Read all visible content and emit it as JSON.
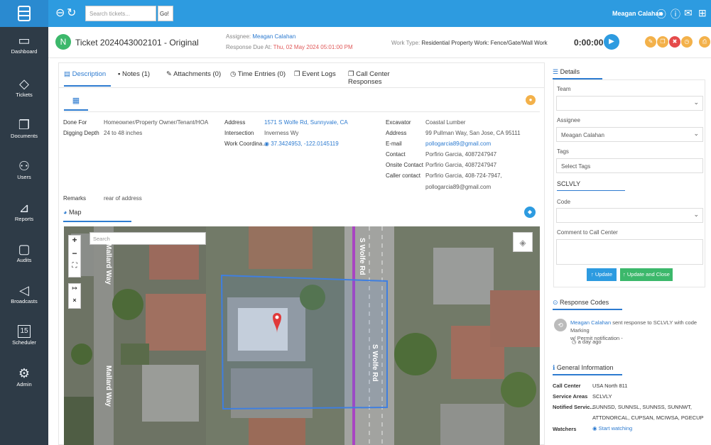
{
  "topbar": {
    "search_placeholder": "Search tickets...",
    "go_label": "Go!",
    "user_name": "Meagan Calahan"
  },
  "sidebar": {
    "items": [
      {
        "label": "Dashboard",
        "icon": "monitor-icon"
      },
      {
        "label": "Tickets",
        "icon": "tag-icon"
      },
      {
        "label": "Documents",
        "icon": "documents-icon"
      },
      {
        "label": "Users",
        "icon": "users-icon"
      },
      {
        "label": "Reports",
        "icon": "chart-icon"
      },
      {
        "label": "Audits",
        "icon": "audits-icon"
      },
      {
        "label": "Broadcasts",
        "icon": "megaphone-icon"
      },
      {
        "label": "Scheduler",
        "icon": "calendar-icon"
      },
      {
        "label": "Admin",
        "icon": "gear-icon"
      }
    ],
    "calendar_day": "15"
  },
  "ticket": {
    "avatar_letter": "N",
    "title": "Ticket 2024043002101 - Original",
    "assignee_label": "Assignee:",
    "assignee_value": "Meagan Calahan",
    "due_label": "Response Due At:",
    "due_value": "Thu, 02 May 2024 05:01:00 PM",
    "worktype_label": "Work Type:",
    "worktype_value": "Residential Property Work: Fence/Gate/Wall Work",
    "timer": "0:00:00"
  },
  "tabs": [
    {
      "label": "Description"
    },
    {
      "label": "Notes (1)"
    },
    {
      "label": "Attachments (0)"
    },
    {
      "label": "Time Entries (0)"
    },
    {
      "label": "Event Logs"
    },
    {
      "label": "Call Center Responses"
    }
  ],
  "description": {
    "done_for_label": "Done For",
    "done_for_value": "Homeowner/Property Owner/Tenant/HOA",
    "digging_depth_label": "Digging Depth",
    "digging_depth_value": "24 to 48 inches",
    "address_label": "Address",
    "address_value": "1571 S Wolfe Rd, Sunnyvale, CA",
    "intersection_label": "Intersection",
    "intersection_value": "Inverness Wy",
    "work_coord_label": "Work Coordina...",
    "work_coord_value": "37.3424953, -122.0145119",
    "excavator_label": "Excavator",
    "excavator_value": "Coastal Lumber",
    "ex_address_label": "Address",
    "ex_address_value": "99 Pullman Way, San Jose, CA 95111",
    "email_label": "E-mail",
    "email_value": "pollogarcia89@gmail.com",
    "contact_label": "Contact",
    "contact_value": "Porfirio Garcia, 4087247947",
    "onsite_label": "Onsite Contact",
    "onsite_value": "Porfirio Garcia, 4087247947",
    "caller_label": "Caller contact",
    "caller_value_1": "Porfirio Garcia, 408-724-7947,",
    "caller_value_2": "pollogarcia89@gmail.com",
    "remarks_label": "Remarks",
    "remarks_value": "rear of address",
    "map_label": "Map"
  },
  "map": {
    "search_placeholder": "Search",
    "street_1": "S Wolfe Rd",
    "street_2": "S Wolfe Rd",
    "street_3": "Mallard Way",
    "street_4": "Mallard Way"
  },
  "details": {
    "header": "Details",
    "team_label": "Team",
    "assignee_label": "Assignee",
    "assignee_value": "Meagan Calahan",
    "tags_label": "Tags",
    "tags_placeholder": "Select Tags",
    "sclvly_header": "SCLVLY",
    "code_label": "Code",
    "comment_label": "Comment to Call Center",
    "update_label": "Update",
    "update_close_label": "Update and Close"
  },
  "response_codes": {
    "header": "Response Codes",
    "author": "Meagan Calahan",
    "text_1": "sent response to SCLVLY with code Marking",
    "text_2": "w/ Permit notification -",
    "time": "a day ago"
  },
  "general": {
    "header": "General Information",
    "call_center_label": "Call Center",
    "call_center_value": "USA North 811",
    "service_areas_label": "Service Areas",
    "service_areas_value": "SCLVLY",
    "notified_label": "Notified Servic...",
    "notified_value_1": "SUNNSD, SUNNSL, SUNNSS, SUNNWT,",
    "notified_value_2": "ATTDNORCAL, CUPSAN, MCIWSA, PGECUP",
    "watchers_label": "Watchers",
    "watchers_value": "Start watching"
  },
  "colors": {
    "topbar": "#2d9be0",
    "sidebar": "#2e3b47",
    "accent": "#2d7bd0",
    "update_btn": "#2d9be0",
    "update_close_btn": "#3cb86b"
  }
}
